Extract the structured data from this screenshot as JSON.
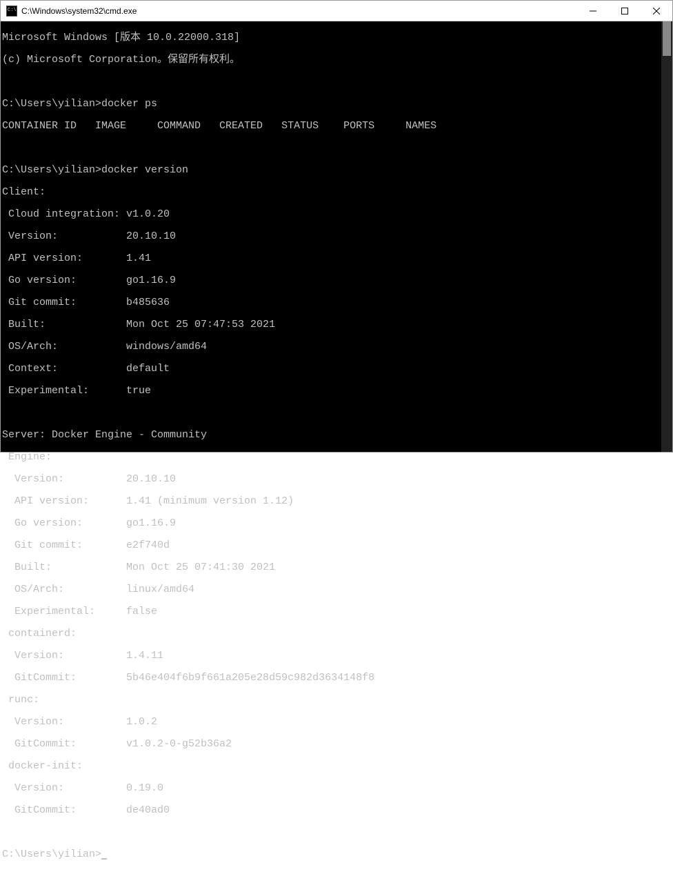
{
  "window": {
    "title": "C:\\Windows\\system32\\cmd.exe"
  },
  "terminal": {
    "line01": "Microsoft Windows [版本 10.0.22000.318]",
    "line02": "(c) Microsoft Corporation。保留所有权利。",
    "line03": "",
    "line04": "C:\\Users\\yilian>docker ps",
    "line05": "CONTAINER ID   IMAGE     COMMAND   CREATED   STATUS    PORTS     NAMES",
    "line06": "",
    "line07": "C:\\Users\\yilian>docker version",
    "line08": "Client:",
    "line09": " Cloud integration: v1.0.20",
    "line10": " Version:           20.10.10",
    "line11": " API version:       1.41",
    "line12": " Go version:        go1.16.9",
    "line13": " Git commit:        b485636",
    "line14": " Built:             Mon Oct 25 07:47:53 2021",
    "line15": " OS/Arch:           windows/amd64",
    "line16": " Context:           default",
    "line17": " Experimental:      true",
    "line18": "",
    "line19": "Server: Docker Engine - Community",
    "line20": " Engine:",
    "line21": "  Version:          20.10.10",
    "line22": "  API version:      1.41 (minimum version 1.12)",
    "line23": "  Go version:       go1.16.9",
    "line24": "  Git commit:       e2f740d",
    "line25": "  Built:            Mon Oct 25 07:41:30 2021",
    "line26": "  OS/Arch:          linux/amd64",
    "line27": "  Experimental:     false",
    "line28": " containerd:",
    "line29": "  Version:          1.4.11",
    "line30": "  GitCommit:        5b46e404f6b9f661a205e28d59c982d3634148f8",
    "line31": " runc:",
    "line32": "  Version:          1.0.2",
    "line33": "  GitCommit:        v1.0.2-0-g52b36a2",
    "line34": " docker-init:",
    "line35": "  Version:          0.19.0",
    "line36": "  GitCommit:        de40ad0",
    "line37": "",
    "line38": "C:\\Users\\yilian>"
  }
}
